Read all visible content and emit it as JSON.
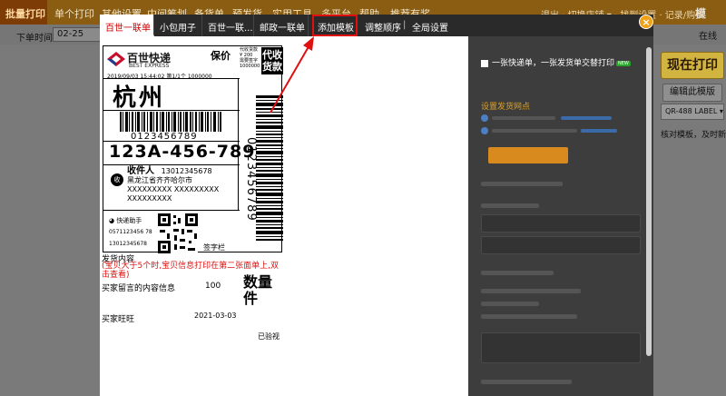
{
  "app": {
    "topbar": {
      "tabs": [
        "批量打印",
        "单个打印",
        "其他设置",
        "中间筹划",
        "备货单",
        "预发货",
        "实用工具",
        "多平台",
        "帮助",
        "推荐有奖"
      ],
      "right_text": "退出 · 切换店铺 ▾ · 找到设置 · 记录/购买",
      "logo": "模"
    },
    "subbar": {
      "order_time_label": "下单时间",
      "order_time_value": "02-25",
      "online": "在线"
    },
    "right_panel": {
      "print_now": "现在打印",
      "edit_template": "编辑此模版",
      "printer_select": "QR-488 LABEL",
      "hint": "核对模板，及时新增"
    }
  },
  "modal": {
    "tabs": [
      "百世一联单",
      "小包用子",
      "百世一联...",
      "邮政一联单"
    ],
    "actions": [
      "添加模板",
      "调整顺序",
      "全局设置"
    ],
    "close": "×",
    "label": {
      "brand_cn": "百世快递",
      "brand_en": "BEST EXPRESS",
      "insured": "保价",
      "cod_info": [
        "代收货款",
        "¥ 200",
        "需要签字",
        "1000000"
      ],
      "cod_box": "代收货款",
      "date_line": "2019/09/03  15:44:02  第1/1个  1000000",
      "city": "杭州",
      "barcode_number": "0123456789",
      "sort_code": "123A-456-789",
      "vertical_number": "0123456789",
      "receiver_badge": "收",
      "receiver_title": "收件人",
      "receiver_phone": "13012345678",
      "receiver_address": "黑龙江省齐齐哈尔市",
      "receiver_lines": [
        "XXXXXXXXX XXXXXXXXX",
        "XXXXXXXXX"
      ],
      "sender_icon_text": "快递助手",
      "sender_phone_1": "0571123456 78",
      "sender_phone_2": "13012345678",
      "signature": "签字栏"
    },
    "below_label": {
      "goods_content": "发货内容",
      "warning": "(宝贝大于5个时,宝贝信息打印在第二张面单上,双击查看)",
      "buyer_message": "买家留言的内容信息",
      "quantity": "100",
      "quantity_label": "数量件",
      "buyer_name": "买家旺旺",
      "date": "2021-03-03",
      "status": "已验视"
    },
    "settings": {
      "checkbox_label": "一张快递单，一张发货单交替打印",
      "new_badge": "NEW",
      "network_link": "设置发货网点"
    }
  }
}
